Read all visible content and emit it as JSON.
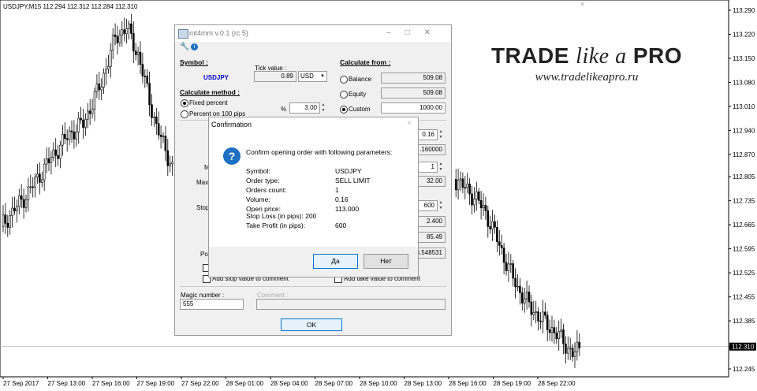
{
  "chart": {
    "header": "USDJPY,M15  112.294 112.312 112.284 112.310",
    "close_glyph": "×",
    "price_labels": [
      "113.290",
      "113.220",
      "113.150",
      "113.080",
      "113.010",
      "112.940",
      "112.870",
      "112.805",
      "112.735",
      "112.665",
      "112.595",
      "112.525",
      "112.455",
      "112.385",
      "112.310",
      "112.245"
    ],
    "current_price": "112.310",
    "time_labels": [
      "27 Sep 2017",
      "27 Sep 13:00",
      "27 Sep 16:00",
      "27 Sep 19:00",
      "27 Sep 22:00",
      "28 Sep 01:00",
      "28 Sep 04:00",
      "28 Sep 07:00",
      "28 Sep 10:00",
      "28 Sep 13:00",
      "28 Sep 16:00",
      "28 Sep 19:00",
      "28 Sep 22:00"
    ]
  },
  "brand": {
    "title_1": "TRADE ",
    "title_2": "like a",
    "title_3": " PRO",
    "url": "www.tradelikeapro.ru"
  },
  "dialog": {
    "title": "mt4mm v.0.1 (rc 5)",
    "symbol_header": "Symbol :",
    "symbol_value": "USDJPY",
    "tick_label": "Tick value :",
    "tick_value": "0.89",
    "tick_currency": "USD",
    "calc_method_header": "Calculate method :",
    "fixed_percent": "Fixed percent",
    "percent_100": "Percent on 100 pips",
    "percent_sign": "%",
    "percent_value": "3.00",
    "calc_from_header": "Calculate from :",
    "balance_label": "Balance",
    "balance_value": "509.08",
    "equity_label": "Equity",
    "equity_value": "509.08",
    "custom_label": "Custom",
    "custom_value": "1000.00",
    "r_val_1": "0.16",
    "r_val_2": ".160000",
    "r_val_3": "1",
    "r_val_4": "32.00",
    "r_val_5": "600",
    "r_val_6": "2.400",
    "r_val_7": "85.49",
    "r_val_8": "3.548531",
    "l_frag_1": "M",
    "l_frag_2": "Maxi",
    "l_frag_3": "Stop",
    "l_frag_4": "Pos",
    "add_stop": "Add stop value to comment",
    "add_take": "Add take value to comment",
    "magic_label": "Magic number :",
    "magic_value": "555",
    "comment_label": "Comment :",
    "ok": "OK"
  },
  "confirm": {
    "title": "Confirmation",
    "close_glyph": "×",
    "message": "Confirm opening order with following parameters:",
    "rows": [
      {
        "k": "Symbol:",
        "v": "USDJPY"
      },
      {
        "k": "Order type:",
        "v": "SELL LIMIT"
      },
      {
        "k": "Orders count:",
        "v": "1"
      },
      {
        "k": "Volume:",
        "v": "0.16"
      },
      {
        "k": "Open price:",
        "v": "113.000"
      }
    ],
    "sl_line": "Stop Loss (in pips): 200",
    "tp_key": "Take Profit (in pips):",
    "tp_value": "600",
    "yes": "Да",
    "no": "Нет"
  },
  "colors": {
    "bull": "#ffffff",
    "bear": "#000000",
    "symbol_blue": "#0000cc",
    "accent": "#0078d7"
  }
}
